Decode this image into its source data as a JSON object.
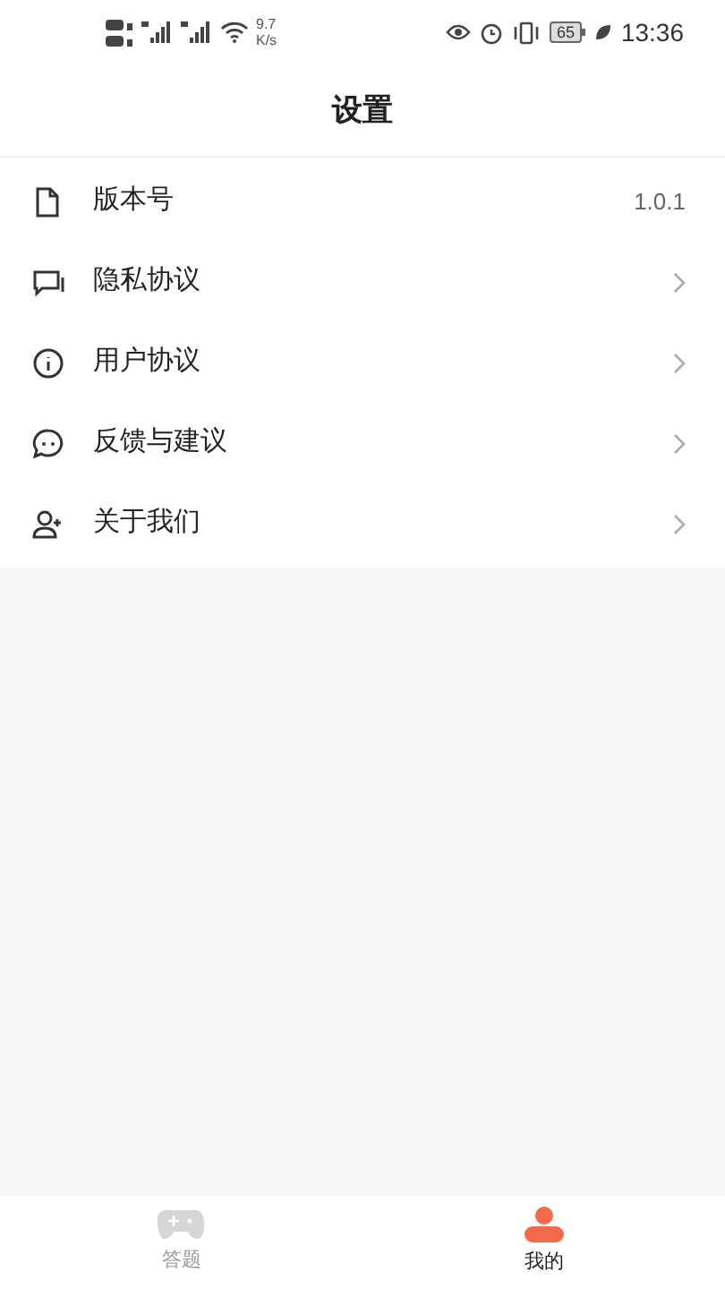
{
  "status_bar": {
    "speed_value": "9.7",
    "speed_unit": "K/s",
    "battery": "65",
    "time": "13:36"
  },
  "title": "设置",
  "items": [
    {
      "label": "版本号",
      "kind": "value",
      "value": "1.0.1"
    },
    {
      "label": "隐私协议",
      "kind": "link"
    },
    {
      "label": "用户协议",
      "kind": "link"
    },
    {
      "label": "反馈与建议",
      "kind": "link"
    },
    {
      "label": "关于我们",
      "kind": "link"
    }
  ],
  "tabs": [
    {
      "label": "答题",
      "selected": false
    },
    {
      "label": "我的",
      "selected": true
    }
  ]
}
